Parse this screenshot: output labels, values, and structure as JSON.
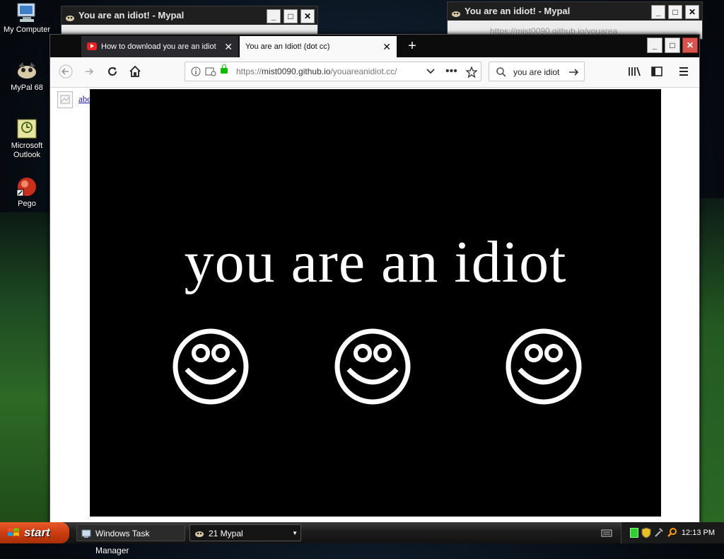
{
  "desktop": {
    "icons": [
      {
        "label": "My Computer"
      },
      {
        "label": "MyPal 68"
      },
      {
        "label": "Microsoft Outlook"
      },
      {
        "label": "Pego"
      }
    ]
  },
  "background_windows": [
    {
      "title": "You are an idiot! - Mypal"
    },
    {
      "title": "You are an idiot! - Mypal",
      "url_fragment": "https://mist0090.github.io/youarea"
    }
  ],
  "browser": {
    "tabs": [
      {
        "label": "How to download you are an idiot",
        "active": false
      },
      {
        "label": "You are an Idiot! (dot cc)",
        "active": true
      }
    ],
    "new_tab_label": "+",
    "url": {
      "scheme": "https://",
      "host": "mist0090.github.io",
      "path": "/youareanidiot.cc/"
    },
    "search_value": "you are idiot",
    "page": {
      "broken_link_text": "about:blank",
      "headline": "you are an idiot",
      "smiley_count": 3
    }
  },
  "taskbar": {
    "start_label": "start",
    "tasks": [
      {
        "label": "Windows Task Manager"
      },
      {
        "label": "21 Mypal"
      }
    ],
    "clock": "12:13 PM"
  },
  "colors": {
    "page_background": "#000000",
    "headline": "#ffffff",
    "lock": "#12bc00",
    "start_button": "#c93b0f"
  }
}
